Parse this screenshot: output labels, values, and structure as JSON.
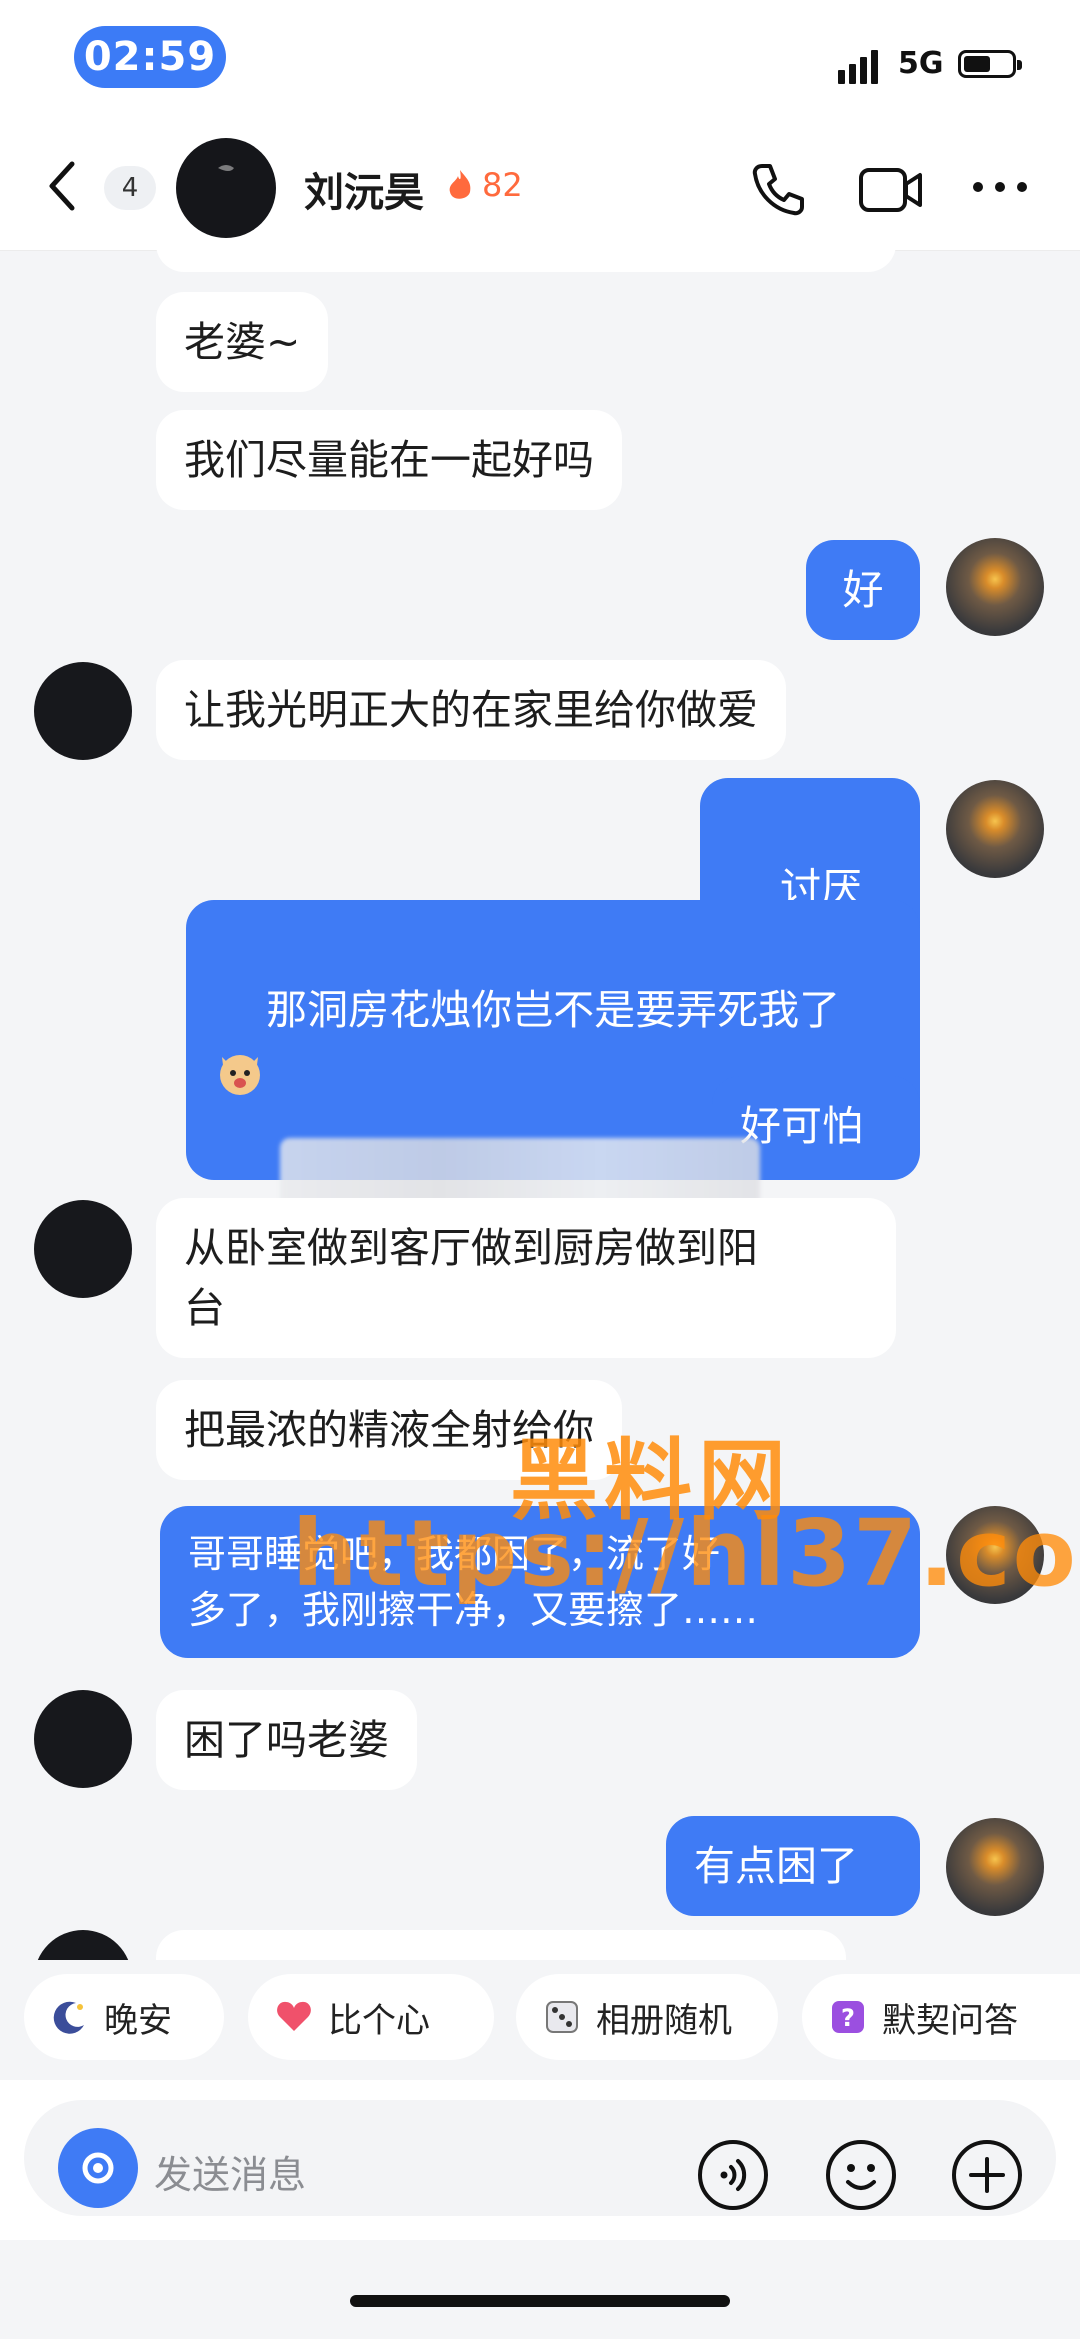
{
  "status_bar": {
    "time": "02:59",
    "network": "5G"
  },
  "header": {
    "unread_count": "4",
    "contact_name": "刘沅昊",
    "streak_count": "82"
  },
  "messages": [
    {
      "side": "in",
      "text": "老婆~"
    },
    {
      "side": "in",
      "text": "我们尽量能在一起好吗"
    },
    {
      "side": "out",
      "text": "好"
    },
    {
      "side": "in",
      "text": "让我光明正大的在家里给你做爱"
    },
    {
      "side": "out",
      "text": "讨厌"
    },
    {
      "side": "out",
      "text": "那洞房花烛你岂不是要弄死我了"
    },
    {
      "side": "out",
      "text": "好可怕"
    },
    {
      "side": "in",
      "text": "从卧室做到客厅做到厨房做到阳\n台"
    },
    {
      "side": "in",
      "text": "把最浓的精液全射给你"
    },
    {
      "side": "out",
      "text": "哥哥睡觉吧，我都困了，流了好\n多了，我刚擦干净，又要擦了……"
    },
    {
      "side": "in",
      "text": "困了吗老婆"
    },
    {
      "side": "out",
      "text": "有点困了"
    }
  ],
  "quick_actions": [
    {
      "label": "晚安",
      "icon": "moon-icon"
    },
    {
      "label": "比个心",
      "icon": "heart-icon"
    },
    {
      "label": "相册随机",
      "icon": "dice-icon"
    },
    {
      "label": "默契问答",
      "icon": "question-icon"
    }
  ],
  "input": {
    "placeholder": "发送消息"
  },
  "watermark": {
    "line1": "黑料网",
    "line2": "https://hl37.co"
  },
  "colors": {
    "accent": "#3f7bf5",
    "background": "#f4f5f7",
    "watermark": "#ff8c0a"
  }
}
